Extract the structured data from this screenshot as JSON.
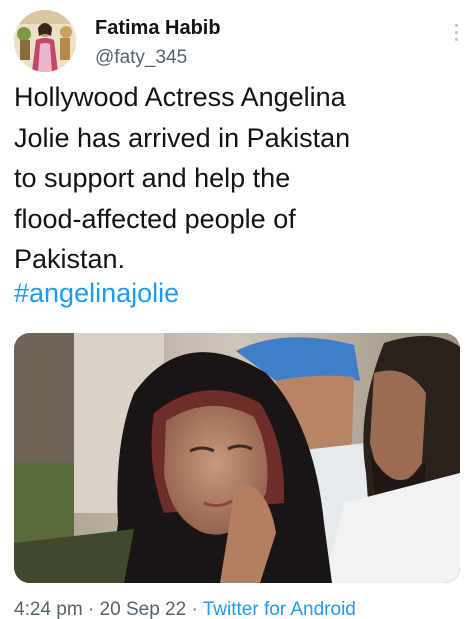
{
  "author": {
    "display_name": "Fatima Habib",
    "handle": "@faty_345",
    "avatar_icon": "profile-photo"
  },
  "tweet": {
    "text_lines": [
      "Hollywood Actress Angelina",
      "Jolie has arrived in Pakistan",
      "to support and help the",
      "flood-affected people of",
      "Pakistan."
    ],
    "hashtag": "#angelinajolie",
    "media_icon": "photo-attachment"
  },
  "meta": {
    "time": "4:24 pm",
    "separator_1": " · ",
    "date": "20 Sep 22",
    "separator_2": " · ",
    "source": "Twitter for Android"
  },
  "colors": {
    "link": "#1d9bf0",
    "secondary_text": "#536471",
    "primary_text": "#0f1419"
  }
}
